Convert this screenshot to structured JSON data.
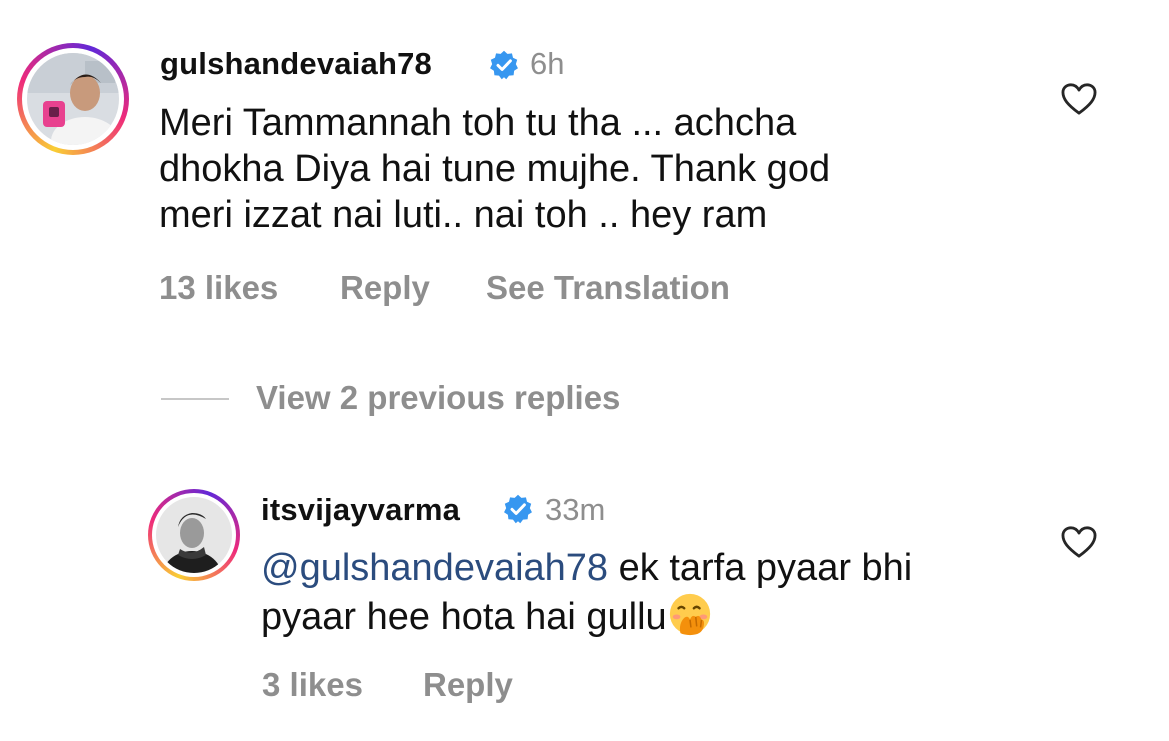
{
  "comment1": {
    "username": "gulshandevaiah78",
    "time": "6h",
    "lines": [
      "Meri Tammannah toh tu tha ... achcha",
      "dhokha Diya hai tune mujhe. Thank god",
      "meri izzat nai luti.. nai toh .. hey ram"
    ],
    "likes": "13 likes",
    "reply": "Reply",
    "translate": "See Translation"
  },
  "view_replies": "View 2 previous replies",
  "reply1": {
    "username": "itsvijayvarma",
    "time": "33m",
    "mention": "@gulshandevaiah78",
    "line1_rest": " ek tarfa pyaar bhi",
    "line2": "pyaar hee hota hai gullu",
    "emoji": "face-with-hand-over-mouth",
    "likes": "3 likes",
    "reply": "Reply"
  },
  "colors": {
    "verified_blue": "#3797f0",
    "muted_text": "#8e8e8e",
    "mention": "#2b4c7e"
  }
}
